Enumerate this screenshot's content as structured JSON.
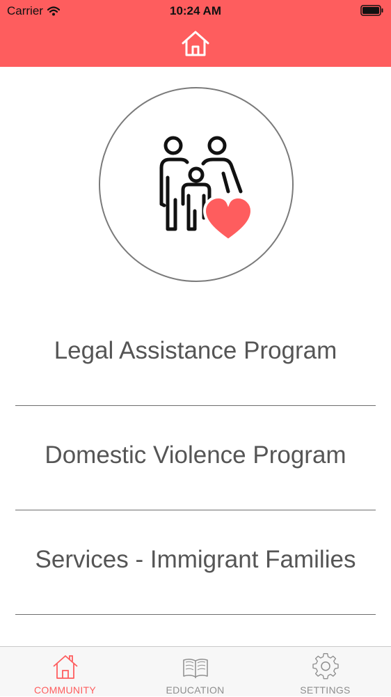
{
  "status_bar": {
    "carrier": "Carrier",
    "time": "10:24 AM",
    "wifi_icon": "wifi-icon",
    "battery_icon": "battery-icon"
  },
  "header": {
    "background": "#fe5d5e",
    "home_icon": "home-icon"
  },
  "hero": {
    "icon": "family-heart-icon",
    "heart_color": "#fe5d5e"
  },
  "programs": [
    {
      "label": "Legal Assistance Program"
    },
    {
      "label": "Domestic Violence Program"
    },
    {
      "label": "Services - Immigrant Families"
    }
  ],
  "tabs": [
    {
      "label": "COMMUNITY",
      "icon": "home-icon",
      "active": true
    },
    {
      "label": "EDUCATION",
      "icon": "book-icon",
      "active": false
    },
    {
      "label": "SETTINGS",
      "icon": "gear-icon",
      "active": false
    }
  ],
  "colors": {
    "accent": "#fe5d5e",
    "text": "#555555",
    "inactive_tab": "#8e8e8e"
  }
}
